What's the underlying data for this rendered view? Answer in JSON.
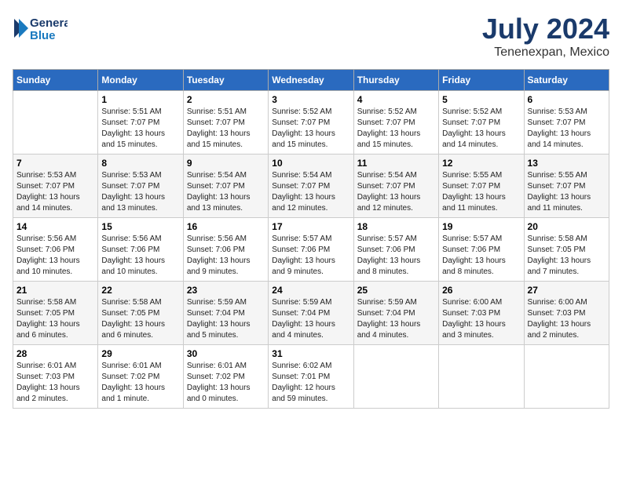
{
  "header": {
    "logo_line1": "General",
    "logo_line2": "Blue",
    "month_year": "July 2024",
    "location": "Tenenexpan, Mexico"
  },
  "days_of_week": [
    "Sunday",
    "Monday",
    "Tuesday",
    "Wednesday",
    "Thursday",
    "Friday",
    "Saturday"
  ],
  "weeks": [
    [
      {
        "day": "",
        "info": ""
      },
      {
        "day": "1",
        "info": "Sunrise: 5:51 AM\nSunset: 7:07 PM\nDaylight: 13 hours\nand 15 minutes."
      },
      {
        "day": "2",
        "info": "Sunrise: 5:51 AM\nSunset: 7:07 PM\nDaylight: 13 hours\nand 15 minutes."
      },
      {
        "day": "3",
        "info": "Sunrise: 5:52 AM\nSunset: 7:07 PM\nDaylight: 13 hours\nand 15 minutes."
      },
      {
        "day": "4",
        "info": "Sunrise: 5:52 AM\nSunset: 7:07 PM\nDaylight: 13 hours\nand 15 minutes."
      },
      {
        "day": "5",
        "info": "Sunrise: 5:52 AM\nSunset: 7:07 PM\nDaylight: 13 hours\nand 14 minutes."
      },
      {
        "day": "6",
        "info": "Sunrise: 5:53 AM\nSunset: 7:07 PM\nDaylight: 13 hours\nand 14 minutes."
      }
    ],
    [
      {
        "day": "7",
        "info": "Sunrise: 5:53 AM\nSunset: 7:07 PM\nDaylight: 13 hours\nand 14 minutes."
      },
      {
        "day": "8",
        "info": "Sunrise: 5:53 AM\nSunset: 7:07 PM\nDaylight: 13 hours\nand 13 minutes."
      },
      {
        "day": "9",
        "info": "Sunrise: 5:54 AM\nSunset: 7:07 PM\nDaylight: 13 hours\nand 13 minutes."
      },
      {
        "day": "10",
        "info": "Sunrise: 5:54 AM\nSunset: 7:07 PM\nDaylight: 13 hours\nand 12 minutes."
      },
      {
        "day": "11",
        "info": "Sunrise: 5:54 AM\nSunset: 7:07 PM\nDaylight: 13 hours\nand 12 minutes."
      },
      {
        "day": "12",
        "info": "Sunrise: 5:55 AM\nSunset: 7:07 PM\nDaylight: 13 hours\nand 11 minutes."
      },
      {
        "day": "13",
        "info": "Sunrise: 5:55 AM\nSunset: 7:07 PM\nDaylight: 13 hours\nand 11 minutes."
      }
    ],
    [
      {
        "day": "14",
        "info": "Sunrise: 5:56 AM\nSunset: 7:06 PM\nDaylight: 13 hours\nand 10 minutes."
      },
      {
        "day": "15",
        "info": "Sunrise: 5:56 AM\nSunset: 7:06 PM\nDaylight: 13 hours\nand 10 minutes."
      },
      {
        "day": "16",
        "info": "Sunrise: 5:56 AM\nSunset: 7:06 PM\nDaylight: 13 hours\nand 9 minutes."
      },
      {
        "day": "17",
        "info": "Sunrise: 5:57 AM\nSunset: 7:06 PM\nDaylight: 13 hours\nand 9 minutes."
      },
      {
        "day": "18",
        "info": "Sunrise: 5:57 AM\nSunset: 7:06 PM\nDaylight: 13 hours\nand 8 minutes."
      },
      {
        "day": "19",
        "info": "Sunrise: 5:57 AM\nSunset: 7:06 PM\nDaylight: 13 hours\nand 8 minutes."
      },
      {
        "day": "20",
        "info": "Sunrise: 5:58 AM\nSunset: 7:05 PM\nDaylight: 13 hours\nand 7 minutes."
      }
    ],
    [
      {
        "day": "21",
        "info": "Sunrise: 5:58 AM\nSunset: 7:05 PM\nDaylight: 13 hours\nand 6 minutes."
      },
      {
        "day": "22",
        "info": "Sunrise: 5:58 AM\nSunset: 7:05 PM\nDaylight: 13 hours\nand 6 minutes."
      },
      {
        "day": "23",
        "info": "Sunrise: 5:59 AM\nSunset: 7:04 PM\nDaylight: 13 hours\nand 5 minutes."
      },
      {
        "day": "24",
        "info": "Sunrise: 5:59 AM\nSunset: 7:04 PM\nDaylight: 13 hours\nand 4 minutes."
      },
      {
        "day": "25",
        "info": "Sunrise: 5:59 AM\nSunset: 7:04 PM\nDaylight: 13 hours\nand 4 minutes."
      },
      {
        "day": "26",
        "info": "Sunrise: 6:00 AM\nSunset: 7:03 PM\nDaylight: 13 hours\nand 3 minutes."
      },
      {
        "day": "27",
        "info": "Sunrise: 6:00 AM\nSunset: 7:03 PM\nDaylight: 13 hours\nand 2 minutes."
      }
    ],
    [
      {
        "day": "28",
        "info": "Sunrise: 6:01 AM\nSunset: 7:03 PM\nDaylight: 13 hours\nand 2 minutes."
      },
      {
        "day": "29",
        "info": "Sunrise: 6:01 AM\nSunset: 7:02 PM\nDaylight: 13 hours\nand 1 minute."
      },
      {
        "day": "30",
        "info": "Sunrise: 6:01 AM\nSunset: 7:02 PM\nDaylight: 13 hours\nand 0 minutes."
      },
      {
        "day": "31",
        "info": "Sunrise: 6:02 AM\nSunset: 7:01 PM\nDaylight: 12 hours\nand 59 minutes."
      },
      {
        "day": "",
        "info": ""
      },
      {
        "day": "",
        "info": ""
      },
      {
        "day": "",
        "info": ""
      }
    ]
  ]
}
